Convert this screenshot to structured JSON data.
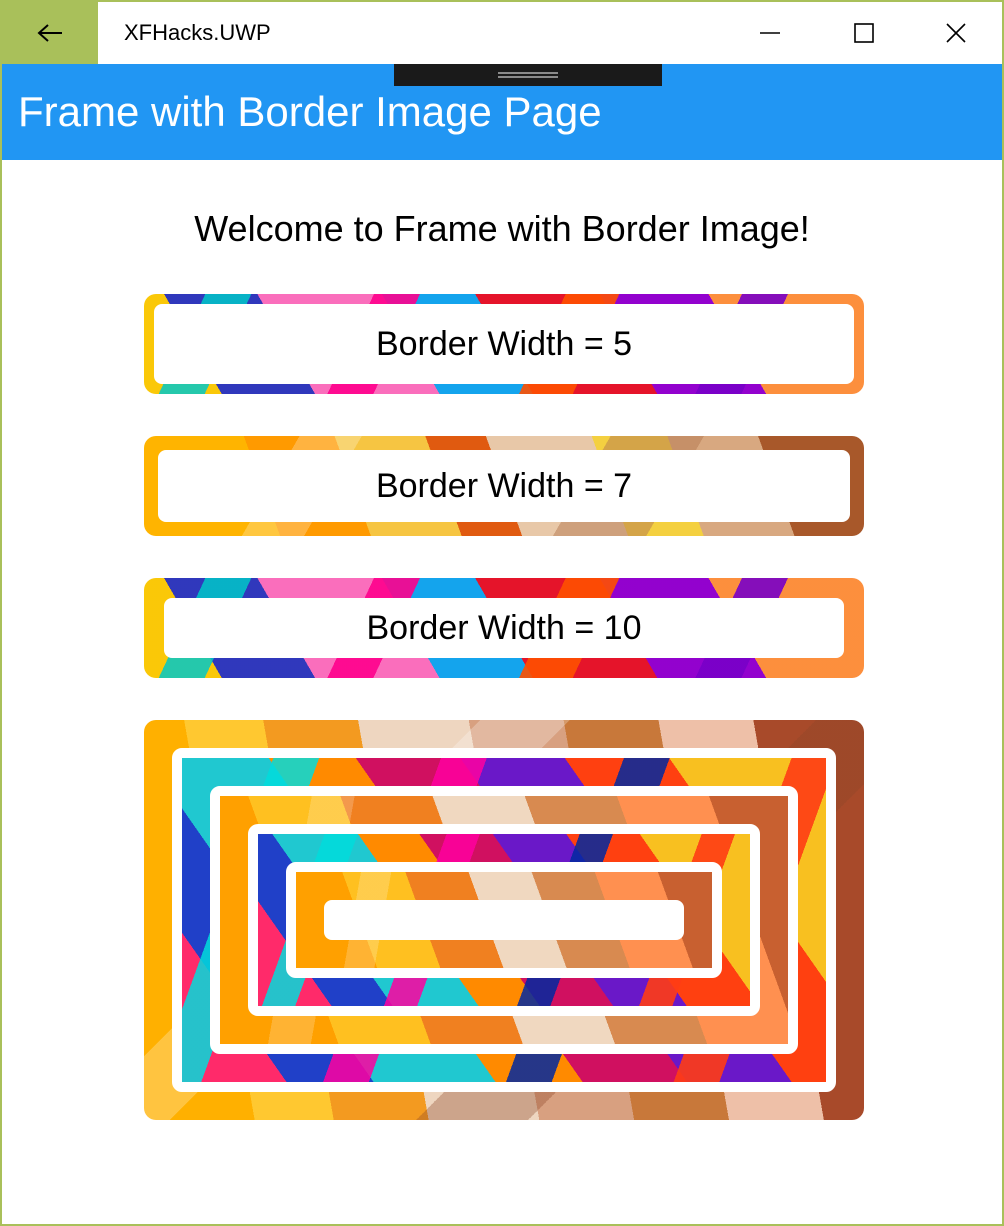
{
  "titlebar": {
    "app_name": "XFHacks.UWP",
    "back_icon": "arrow-left-icon",
    "minimize_icon": "minimize-icon",
    "maximize_icon": "maximize-icon",
    "close_icon": "close-icon"
  },
  "header": {
    "title": "Frame with Border Image Page",
    "background": "#2196f3"
  },
  "content": {
    "welcome": "Welcome to Frame with Border Image!",
    "frames": [
      {
        "label": "Border Width = 5"
      },
      {
        "label": "Border Width = 7"
      },
      {
        "label": "Border Width = 10"
      }
    ]
  },
  "colors": {
    "accent": "#a9c05a",
    "header_blue": "#2196f3"
  }
}
